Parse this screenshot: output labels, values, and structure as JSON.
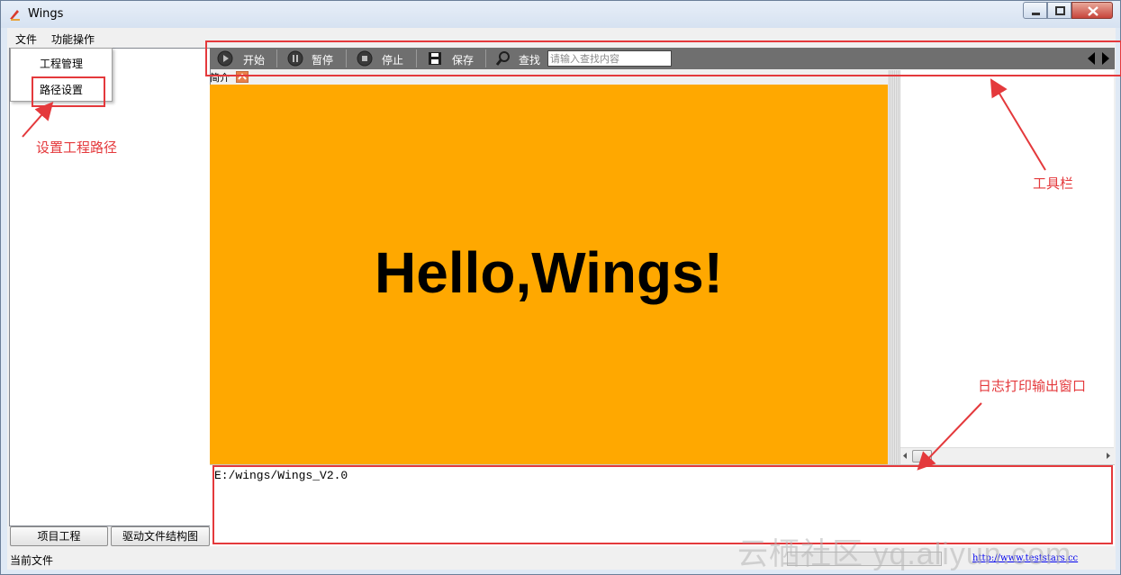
{
  "window": {
    "title": "Wings"
  },
  "menu": {
    "file": "文件",
    "functions": "功能操作"
  },
  "dropdown": {
    "items": [
      "工程管理",
      "路径设置"
    ]
  },
  "toolbar": {
    "start": "开始",
    "pause": "暂停",
    "stop": "停止",
    "save": "保存",
    "find": "查找",
    "search_placeholder": "请输入查找内容"
  },
  "intro": {
    "label": "简介"
  },
  "canvas": {
    "text": "Hello,Wings!",
    "bg_color": "#ffa800"
  },
  "log": {
    "text": "E:/wings/Wings_V2.0"
  },
  "left_tabs": [
    "项目工程",
    "驱动文件结构图"
  ],
  "status": {
    "current_file": "当前文件",
    "link": "http://www.teststars.cc"
  },
  "annotations": {
    "path_setting": "设置工程路径",
    "toolbar": "工具栏",
    "log_window": "日志打印输出窗口",
    "color": "#e4393c"
  },
  "watermark": "云栖社区 yq.aliyun.com"
}
